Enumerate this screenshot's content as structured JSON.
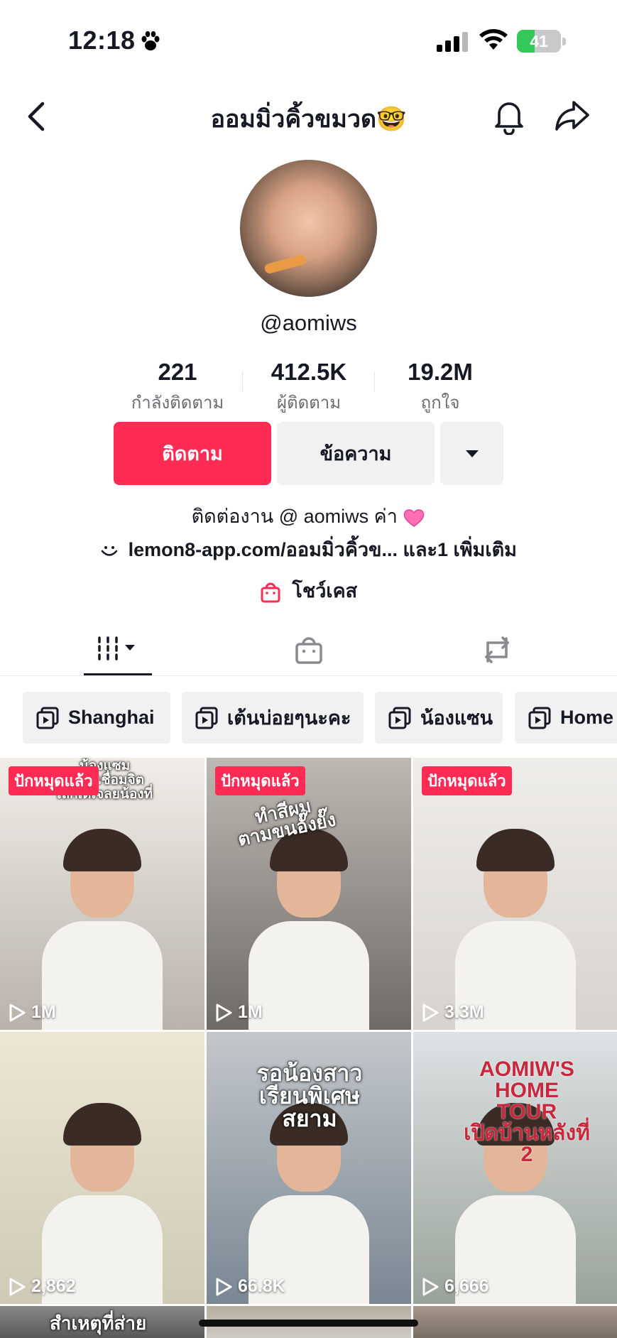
{
  "status_bar": {
    "time": "12:18",
    "battery_level": "41",
    "battery_fraction": 0.41,
    "icons": [
      "paw-icon",
      "signal-icon",
      "wifi-icon",
      "battery-icon"
    ]
  },
  "nav": {
    "title": "ออมมิ่วคิ้วขมวด🤓",
    "icons": [
      "back-arrow-icon",
      "bell-icon",
      "share-icon"
    ]
  },
  "profile": {
    "handle": "@aomiws",
    "stats": [
      {
        "value": "221",
        "label": "กำลังติดตาม"
      },
      {
        "value": "412.5K",
        "label": "ผู้ติดตาม"
      },
      {
        "value": "19.2M",
        "label": "ถูกใจ"
      }
    ],
    "buttons": {
      "follow": "ติดตาม",
      "message": "ข้อความ"
    },
    "bio": "ติดต่องาน @ aomiws ค่า",
    "link": "lemon8-app.com/ออมมิ่วคิ้วข...",
    "link_more": "และ1 เพิ่มเติม",
    "showcase": "โชว์เคส"
  },
  "tabs": [
    "videos-grid-icon",
    "shopping-bag-icon",
    "repost-icon"
  ],
  "playlists": [
    "Shanghai",
    "เต้นบ่อยๆนะคะ",
    "น้องแซน",
    "Home"
  ],
  "videos": [
    {
      "badge": "ปักหมุดแล้ว",
      "views": "1M",
      "caption": "น้องแซม\nไม่ได้เชื่อมจิต\nเลิกเดเจลยน้องที่",
      "palette": [
        "#b9b2ab",
        "#f1ede8"
      ]
    },
    {
      "badge": "ปักหมุดแล้ว",
      "views": "1M",
      "caption": "ทำสีผม\nตามขนอั๊งยั๊ง",
      "palette": [
        "#6f6a66",
        "#bdb8b2"
      ]
    },
    {
      "badge": "ปักหมุดแล้ว",
      "views": "3.3M",
      "caption": "",
      "palette": [
        "#d6d3cf",
        "#efedea"
      ]
    },
    {
      "badge": "",
      "views": "2,862",
      "caption": "",
      "palette": [
        "#cfc9b8",
        "#ece6d3"
      ]
    },
    {
      "badge": "",
      "views": "66.8K",
      "caption": "รอน้องสาว\nเรียนพิเศษ\nสยาม",
      "palette": [
        "#7a8793",
        "#c2c7cb"
      ]
    },
    {
      "badge": "",
      "views": "6,666",
      "caption": "AOMIW'S\nHOME\nTOUR\nเปิดบ้านหลังที่ 2",
      "palette": [
        "#9aa39a",
        "#dde2e4"
      ]
    },
    {
      "badge": "",
      "views": "",
      "caption": "สำเหตุที่ส่าย",
      "palette": [
        "#4c4a48",
        "#8a8886"
      ]
    },
    {
      "badge": "",
      "views": "",
      "caption": "",
      "palette": [
        "#d7d4cf",
        "#b7ae9f"
      ]
    },
    {
      "badge": "",
      "views": "",
      "caption": "",
      "palette": [
        "#6b5f57",
        "#a7988c"
      ]
    }
  ],
  "colors": {
    "accent": "#fe2c55",
    "secondary_button": "#f1f1f2",
    "text": "#161823",
    "muted_text": "#6c6d72"
  }
}
